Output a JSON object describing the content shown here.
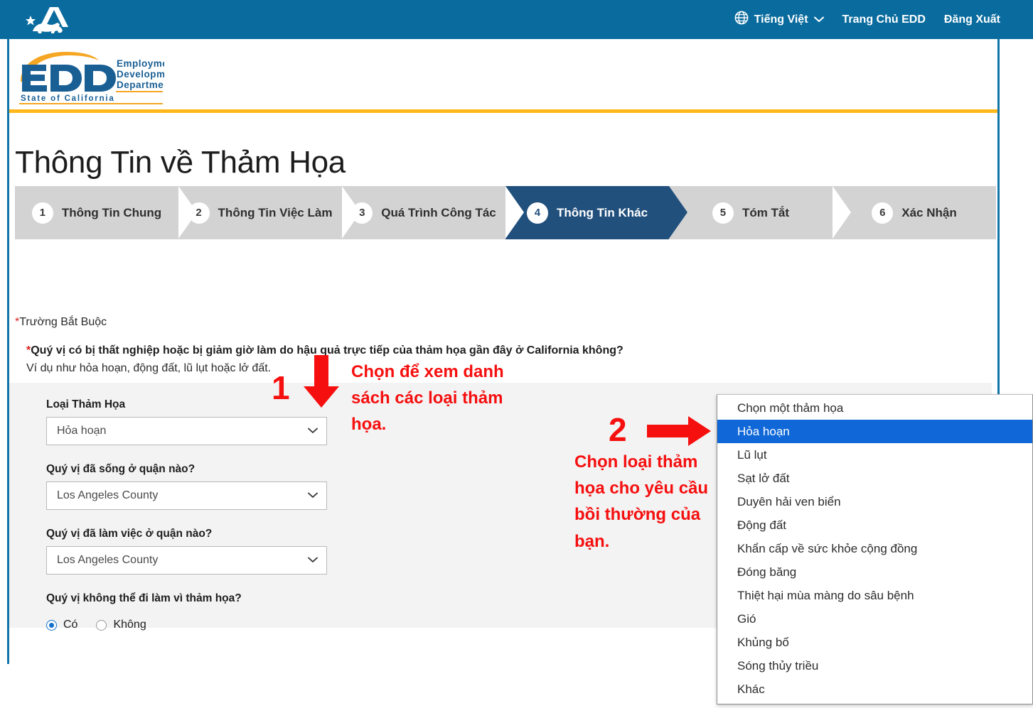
{
  "topbar": {
    "state_logo_alt": "California state logo",
    "language": "Tiếng Việt",
    "links": [
      {
        "label": "Trang Chủ EDD"
      },
      {
        "label": "Đăng Xuất"
      }
    ]
  },
  "brand": {
    "acronym": "EDD",
    "line1": "Employment",
    "line2": "Development",
    "line3": "Department",
    "line4": "State of California"
  },
  "page": {
    "title": "Thông Tin về Thảm Họa"
  },
  "steps": [
    {
      "num": "1",
      "label": "Thông Tin Chung",
      "active": false
    },
    {
      "num": "2",
      "label": "Thông Tin Việc Làm",
      "active": false
    },
    {
      "num": "3",
      "label": "Quá Trình Công Tác",
      "active": false
    },
    {
      "num": "4",
      "label": "Thông Tin Khác",
      "active": true
    },
    {
      "num": "5",
      "label": "Tóm Tắt",
      "active": false
    },
    {
      "num": "6",
      "label": "Xác Nhận",
      "active": false
    }
  ],
  "form": {
    "required_note_star": "*",
    "required_note": "Trường Bắt Buộc",
    "main_question_star": "*",
    "main_question": "Quý vị có bị thất nghiệp hoặc bị giảm giờ làm do hậu quả trực tiếp của thảm họa gần đây ở California không?",
    "main_question_hint": "Ví dụ như hỏa hoạn, động đất, lũ lụt hoặc lở đất.",
    "yes_label": "Có",
    "no_label": "Không",
    "main_answer": "Có",
    "disaster_type_label": "Loại Thảm Họa",
    "disaster_type_value": "Hỏa hoạn",
    "lived_county_label": "Quý vị đã sống ở quận nào?",
    "lived_county_value": "Los Angeles County",
    "worked_county_label": "Quý vị đã làm việc ở quận nào?",
    "worked_county_value": "Los Angeles County",
    "unable_work_label": "Quý vị không thể đi làm vì thảm họa?",
    "unable_work_yes": "Có",
    "unable_work_no": "Không",
    "unable_work_answer": "Có"
  },
  "annotations": [
    {
      "number": "1",
      "text": "Chọn để xem danh sách các loại thảm họa.",
      "arrow": "arrow-down-icon"
    },
    {
      "number": "2",
      "text": "Chọn loại thảm họa cho yêu cầu bồi thường của bạn.",
      "arrow": "arrow-right-icon"
    }
  ],
  "dropdown": {
    "items": [
      {
        "label": "Chọn một thảm họa",
        "selected": false
      },
      {
        "label": "Hỏa hoạn",
        "selected": true
      },
      {
        "label": "Lũ lụt",
        "selected": false
      },
      {
        "label": "Sạt lở đất",
        "selected": false
      },
      {
        "label": "Duyên hải ven biển",
        "selected": false
      },
      {
        "label": "Động đất",
        "selected": false
      },
      {
        "label": "Khẩn cấp về sức khỏe cộng đồng",
        "selected": false
      },
      {
        "label": "Đóng băng",
        "selected": false
      },
      {
        "label": "Thiệt hại mùa màng do sâu bệnh",
        "selected": false
      },
      {
        "label": "Gió",
        "selected": false
      },
      {
        "label": "Khủng bố",
        "selected": false
      },
      {
        "label": "Sóng thủy triều",
        "selected": false
      },
      {
        "label": "Khác",
        "selected": false
      }
    ]
  },
  "colors": {
    "header_blue": "#0a6c9e",
    "active_step_navy": "#22507d",
    "inactive_step_gray": "#d3d3d3",
    "brand_orange": "#ffb81c",
    "annotation_red": "#f60f0f",
    "dropdown_highlight": "#1068d8",
    "panel_gray": "#f3f3f3",
    "radio_blue": "#1171cc"
  }
}
